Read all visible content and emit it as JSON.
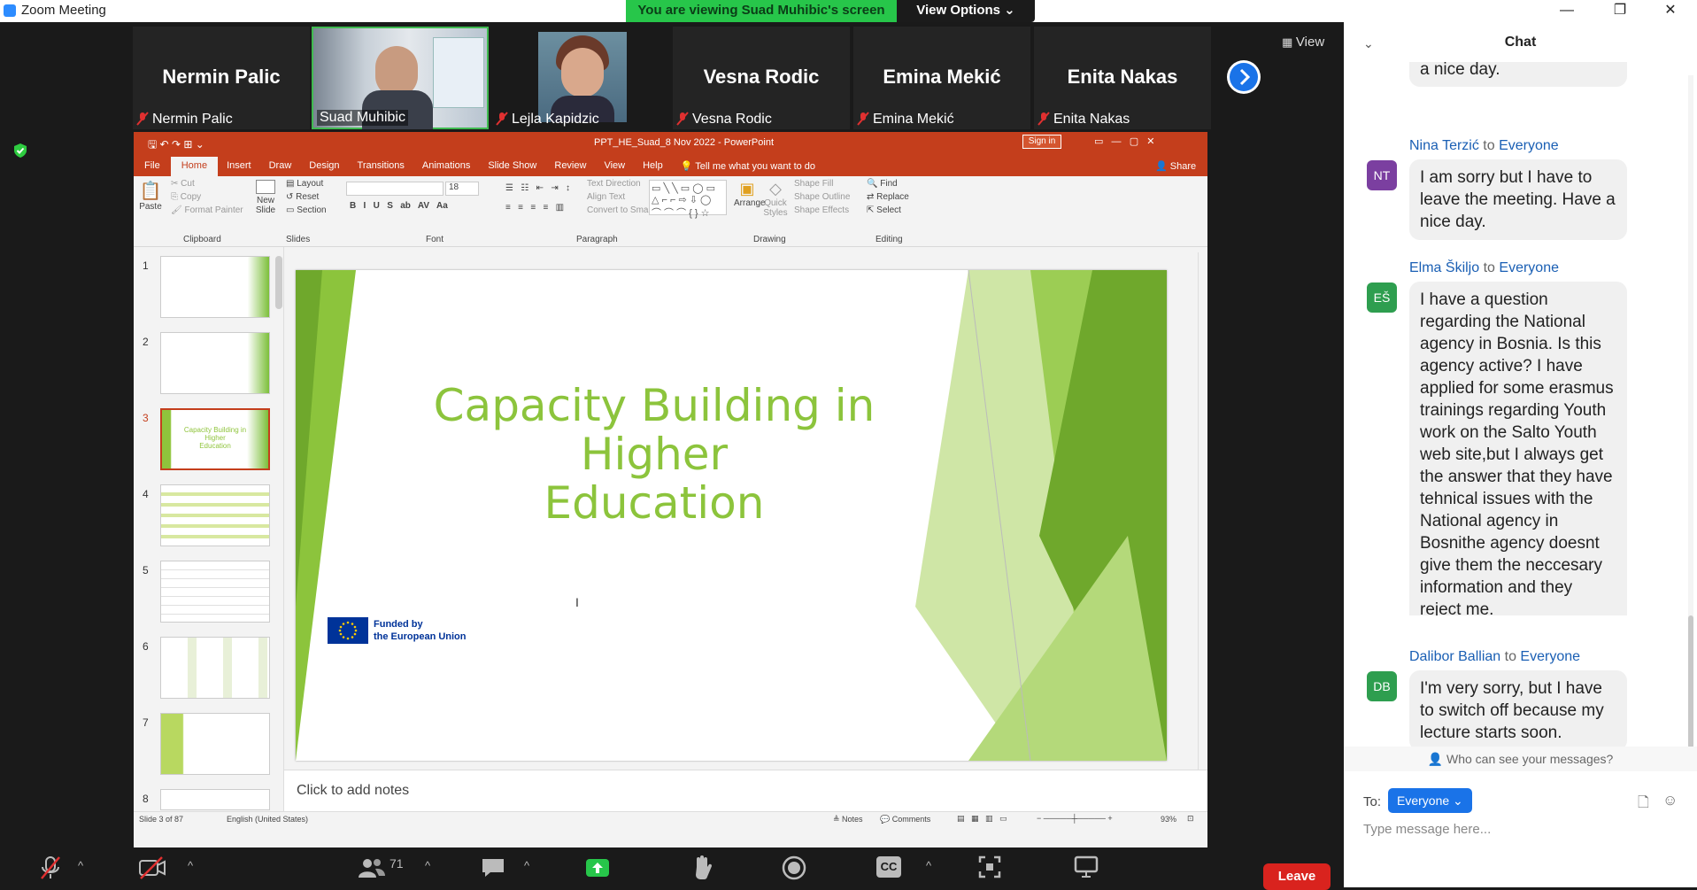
{
  "window": {
    "title": "Zoom Meeting"
  },
  "banner": {
    "viewing": "You are viewing Suad Muhibic's screen",
    "view_options": "View Options ⌄"
  },
  "gallery": {
    "view_label": "View",
    "participants": [
      {
        "name": "Nermin Palic",
        "label": "Nermin Palic",
        "video": false
      },
      {
        "name": "Suad Muhibic",
        "label": "Suad Muhibic",
        "video": true
      },
      {
        "name": "Lejla Kapidzic",
        "label": "Lejla Kapidzic",
        "video": true
      },
      {
        "name": "Vesna Rodic",
        "label": "Vesna Rodic",
        "video": false
      },
      {
        "name": "Emina Mekić",
        "label": "Emina Mekić",
        "video": false
      },
      {
        "name": "Enita Nakas",
        "label": "Enita Nakas",
        "video": false
      }
    ]
  },
  "powerpoint": {
    "file_title": "PPT_HE_Suad_8 Nov 2022  -  PowerPoint",
    "sign_in": "Sign in",
    "tabs": [
      "File",
      "Home",
      "Insert",
      "Draw",
      "Design",
      "Transitions",
      "Animations",
      "Slide Show",
      "Review",
      "View",
      "Help"
    ],
    "tell_me": "Tell me what you want to do",
    "share": "Share",
    "ribbon": {
      "paste": "Paste",
      "cut": "Cut",
      "copy": "Copy",
      "format_painter": "Format Painter",
      "clipboard": "Clipboard",
      "new_slide": "New Slide",
      "layout": "Layout",
      "reset": "Reset",
      "section": "Section",
      "slides": "Slides",
      "font_size": "18",
      "font": "Font",
      "paragraph": "Paragraph",
      "text_direction": "Text Direction",
      "align_text": "Align Text",
      "convert_smartart": "Convert to SmartArt",
      "arrange": "Arrange",
      "quick_styles": "Quick Styles",
      "shape_fill": "Shape Fill",
      "shape_outline": "Shape Outline",
      "shape_effects": "Shape Effects",
      "drawing": "Drawing",
      "find": "Find",
      "replace": "Replace",
      "select": "Select",
      "editing": "Editing"
    },
    "slide_numbers": [
      "1",
      "2",
      "3",
      "4",
      "5",
      "6",
      "7",
      "8"
    ],
    "current_slide": {
      "title_line1": "Capacity Building in",
      "title_line2": "Higher",
      "title_line3": "Education",
      "eu_line1": "Funded by",
      "eu_line2": "the European Union"
    },
    "notes_placeholder": "Click to add notes",
    "status": {
      "slide": "Slide 3 of 87",
      "language": "English (United States)",
      "notes": "Notes",
      "comments": "Comments",
      "zoom": "93%"
    }
  },
  "chat": {
    "title": "Chat",
    "partial_text": "a nice day.",
    "messages": [
      {
        "initials": "NT",
        "sender": "Nina Terzić",
        "to_word": "to",
        "recipient": "Everyone",
        "color": "#7b3fa0",
        "text": "I am sorry but I have to leave the meeting. Have a nice day."
      },
      {
        "initials": "EŠ",
        "sender": "Elma Škiljo",
        "to_word": "to",
        "recipient": "Everyone",
        "color": "#2e9e4f",
        "text": "I have a question regarding the National agency in Bosnia. Is this agency active? I have applied for some erasmus trainings regarding Youth work on the Salto Youth web site,but I always get the answer that they have tehnical issues with the National agency in Bosnithe agency doesnt give them the neccesary information and they reject me."
      },
      {
        "initials": "DB",
        "sender": "Dalibor Ballian",
        "to_word": "to",
        "recipient": "Everyone",
        "color": "#2e9e4f",
        "text": "I'm very sorry, but I have to switch off because my lecture starts soon."
      }
    ],
    "who_can_see": "Who can see your messages?",
    "to_label": "To:",
    "to_value": "Everyone",
    "input_placeholder": "Type message here..."
  },
  "toolbar": {
    "participant_count": "71",
    "leave": "Leave"
  }
}
